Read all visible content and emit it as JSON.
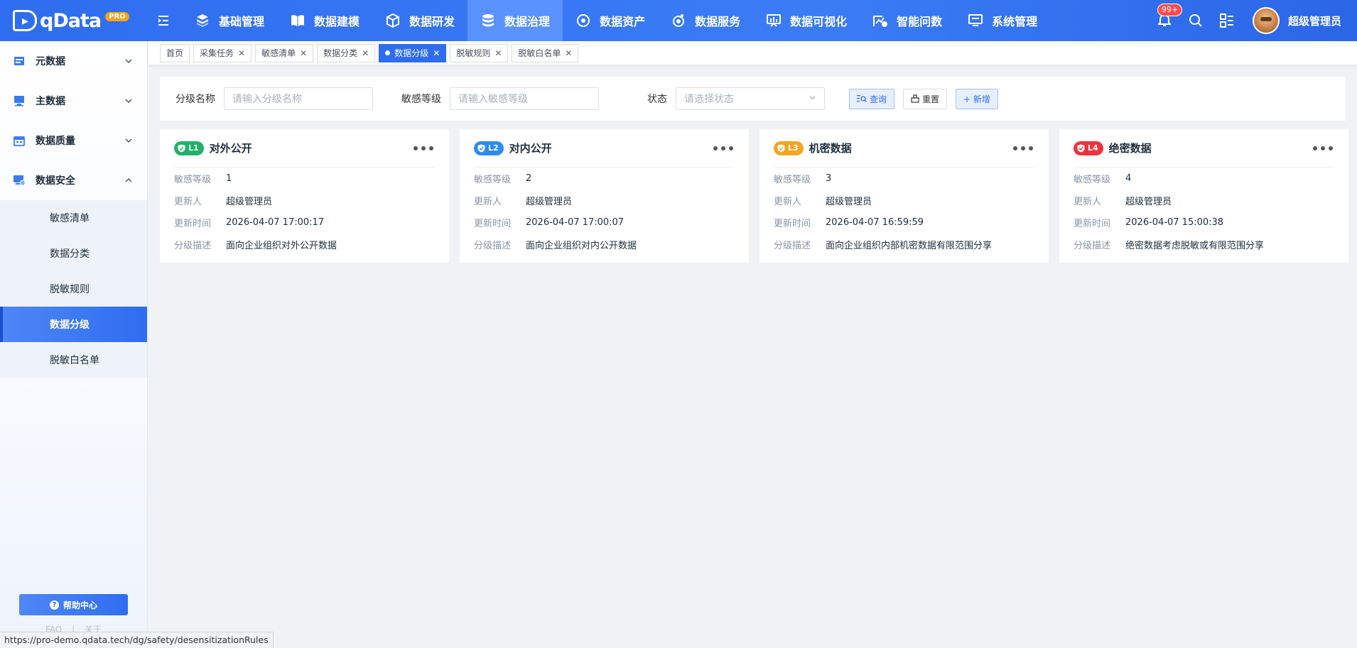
{
  "app": {
    "logo_text": "qData",
    "logo_badge": "PRO"
  },
  "nav": [
    {
      "label": "基础管理",
      "icon": "cube-stack-icon"
    },
    {
      "label": "数据建模",
      "icon": "book-open-icon"
    },
    {
      "label": "数据研发",
      "icon": "package-icon"
    },
    {
      "label": "数据治理",
      "icon": "database-icon",
      "active": true
    },
    {
      "label": "数据资产",
      "icon": "target-icon"
    },
    {
      "label": "数据服务",
      "icon": "service-icon"
    },
    {
      "label": "数据可视化",
      "icon": "chart-board-icon"
    },
    {
      "label": "智能问数",
      "icon": "ai-chart-icon"
    },
    {
      "label": "系统管理",
      "icon": "monitor-gear-icon"
    }
  ],
  "header": {
    "notification_count": "99+",
    "username": "超级管理员"
  },
  "sidebar": {
    "groups": [
      {
        "label": "元数据",
        "expanded": false
      },
      {
        "label": "主数据",
        "expanded": false
      },
      {
        "label": "数据质量",
        "expanded": false
      },
      {
        "label": "数据安全",
        "expanded": true
      }
    ],
    "items": [
      {
        "label": "敏感清单"
      },
      {
        "label": "数据分类"
      },
      {
        "label": "脱敏规则"
      },
      {
        "label": "数据分级",
        "active": true
      },
      {
        "label": "脱敏白名单"
      }
    ],
    "help_label": "帮助中心",
    "faq": "FAQ",
    "separator": "|",
    "about": "关于"
  },
  "tabs": [
    {
      "label": "首页",
      "closable": false
    },
    {
      "label": "采集任务",
      "closable": true
    },
    {
      "label": "敏感清单",
      "closable": true
    },
    {
      "label": "数据分类",
      "closable": true
    },
    {
      "label": "数据分级",
      "closable": true,
      "active": true
    },
    {
      "label": "脱敏规则",
      "closable": true
    },
    {
      "label": "脱敏白名单",
      "closable": true
    }
  ],
  "tab_close_glyph": "✕",
  "search": {
    "name_label": "分级名称",
    "name_placeholder": "请输入分级名称",
    "level_label": "敏感等级",
    "level_placeholder": "请输入敏感等级",
    "status_label": "状态",
    "status_placeholder": "请选择状态",
    "query_label": "查询",
    "reset_label": "重置",
    "add_label": "+ 新增"
  },
  "field_labels": {
    "level": "敏感等级",
    "updater": "更新人",
    "time": "更新时间",
    "desc": "分级描述"
  },
  "cards": [
    {
      "badge": "L1",
      "color": "#20b26b",
      "title": "对外公开",
      "level": "1",
      "updater": "超级管理员",
      "time": "2026-04-07 17:00:17",
      "desc": "面向企业组织对外公开数据"
    },
    {
      "badge": "L2",
      "color": "#2d8cf0",
      "title": "对内公开",
      "level": "2",
      "updater": "超级管理员",
      "time": "2026-04-07 17:00:07",
      "desc": "面向企业组织对内公开数据"
    },
    {
      "badge": "L3",
      "color": "#f5a623",
      "title": "机密数据",
      "level": "3",
      "updater": "超级管理员",
      "time": "2026-04-07 16:59:59",
      "desc": "面向企业组织内部机密数据有限范围分享"
    },
    {
      "badge": "L4",
      "color": "#f0323c",
      "title": "绝密数据",
      "level": "4",
      "updater": "超级管理员",
      "time": "2026-04-07 15:00:38",
      "desc": "绝密数据考虑脱敏或有限范围分享"
    }
  ],
  "status_url": "https://pro-demo.qdata.tech/dg/safety/desensitizationRules"
}
